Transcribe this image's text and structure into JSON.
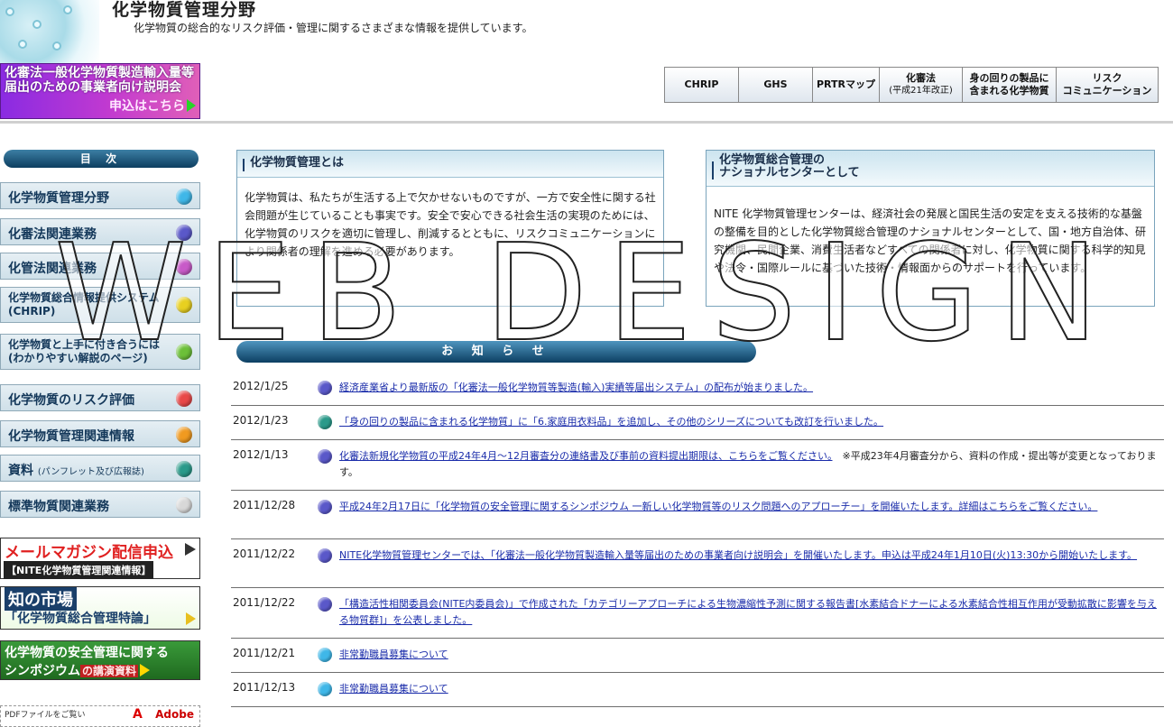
{
  "header": {
    "title": "化学物質管理分野",
    "subtitle": "化学物質の総合的なリスク評価・管理に関するさまざまな情報を提供しています。"
  },
  "event_banner": {
    "line1": "化審法一般化学物質製造輸入量等",
    "line2": "届出のための事業者向け説明会",
    "apply": "申込はこちら"
  },
  "topnav": [
    {
      "line1": "CHRIP",
      "line2": ""
    },
    {
      "line1": "GHS",
      "line2": ""
    },
    {
      "line1": "PRTRマップ",
      "line2": ""
    },
    {
      "line1": "化審法",
      "line2": "(平成21年改正)"
    },
    {
      "line1": "身の回りの製品に",
      "line2": "含まれる化学物質"
    },
    {
      "line1": "リスク",
      "line2": "コミュニケーション"
    }
  ],
  "sidebar": {
    "toc_title": "目 次",
    "items": [
      {
        "line1": "化学物質管理分野",
        "line2": "",
        "color": "#3fb7e8"
      },
      {
        "line1": "化審法関連業務",
        "line2": "",
        "color": "#5a58c9"
      },
      {
        "line1": "化管法関連業務",
        "line2": "",
        "color": "#c85ac8"
      },
      {
        "line1": "化学物質総合情報提供システム",
        "line2": "(CHRIP)",
        "color": "#e8d020"
      },
      {
        "line1": "化学物質と上手に付き合うには",
        "line2": "(わかりやすい解説のページ)",
        "color": "#6cc038"
      },
      {
        "line1": "化学物質のリスク評価",
        "line2": "",
        "color": "#e84848"
      },
      {
        "line1": "化学物質管理関連情報",
        "line2": "",
        "color": "#f09a20"
      },
      {
        "line1": "資料",
        "line2": "(パンフレット及び広報誌)",
        "color": "#2a9a8a"
      },
      {
        "line1": "標準物質関連業務",
        "line2": "",
        "color": "#d8d8d8"
      }
    ],
    "promo_mag": {
      "line1": "メールマガジン配信申込",
      "line2": "【NITE化学物質管理関連情報】"
    },
    "promo_market": {
      "line1": "知の市場",
      "line2": "「化学物質総合管理特論」"
    },
    "promo_symp": {
      "line1": "化学物質の安全管理に関する",
      "line2": "シンポジウム",
      "line3": "の講演資料"
    },
    "pdf_note": "PDFファイルをご覧い",
    "adobe": "Adobe"
  },
  "about": {
    "heading": "化学物質管理とは",
    "body": "化学物質は、私たちが生活する上で欠かせないものですが、一方で安全性に関する社会問題が生じていることも事実です。安全で安心できる社会生活の実現のためには、化学物質のリスクを適切に管理し、削減するとともに、リスクコミュニケーションにより関係者の理解を進める必要があります。"
  },
  "nite": {
    "heading_line1": "化学物質総合管理の",
    "heading_line2": "ナショナルセンターとして",
    "body": "NITE 化学物質管理センターは、経済社会の発展と国民生活の安定を支える技術的な基盤の整備を目的とした化学物質総合管理のナショナルセンターとして、国・地方自治体、研究機関、民間企業、消費生活者などすべての関係者に対し、化学物質に関する科学的知見や法令・国際ルールに基づいた技術・情報面からのサポートを行っています。"
  },
  "news": {
    "title": "お 知 ら せ",
    "items": [
      {
        "date": "2012/1/25",
        "color": "#5a58c9",
        "text": "経済産業省より最新版の「化審法一般化学物質等製造(輸入)実績等届出システム」の配布が始まりました。",
        "note": ""
      },
      {
        "date": "2012/1/23",
        "color": "#2a9a8a",
        "text": "「身の回りの製品に含まれる化学物質」に「6.家庭用衣料品」を追加し、その他のシリーズについても改訂を行いました。",
        "note": ""
      },
      {
        "date": "2012/1/13",
        "color": "#5a58c9",
        "text": "化審法新規化学物質の平成24年4月～12月審査分の連絡書及び事前の資料提出期限は、こちらをご覧ください。",
        "note": "※平成23年4月審査分から、資料の作成・提出等が変更となっております。"
      },
      {
        "date": "2011/12/28",
        "color": "#5a58c9",
        "text": "平成24年2月17日に「化学物質の安全管理に関するシンポジウム 一新しい化学物質等のリスク問題へのアプローチー」を開催いたします。詳細はこちらをご覧ください。",
        "note": ""
      },
      {
        "date": "2011/12/22",
        "color": "#5a58c9",
        "text": "NITE化学物質管理センターでは、「化審法一般化学物質製造輸入量等届出のための事業者向け説明会」を開催いたします。申込は平成24年1月10日(火)13:30から開始いたします。",
        "note": ""
      },
      {
        "date": "2011/12/22",
        "color": "#5a58c9",
        "text": "「構造活性相関委員会(NITE内委員会)」で作成された「カテゴリーアプローチによる生物濃縮性予測に関する報告書[水素結合ドナーによる水素結合性相互作用が受動拡散に影響を与える物質群]」を公表しました。",
        "note": ""
      },
      {
        "date": "2011/12/21",
        "color": "#3fb7e8",
        "text": "非常勤職員募集について",
        "note": ""
      },
      {
        "date": "2011/12/13",
        "color": "#3fb7e8",
        "text": "非常勤職員募集について",
        "note": ""
      }
    ]
  },
  "watermark": "WEB DESIGN"
}
